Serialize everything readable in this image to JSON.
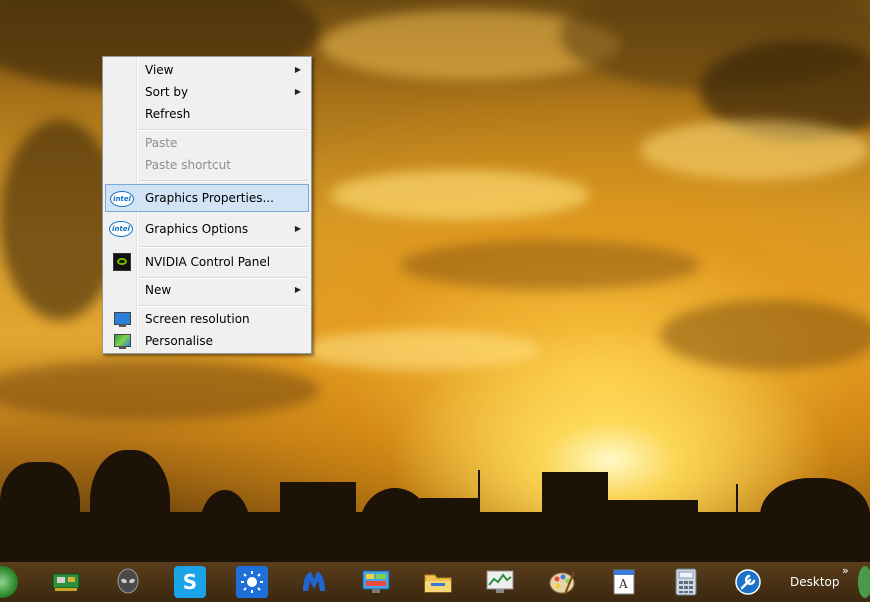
{
  "context_menu": {
    "items": [
      {
        "label": "View",
        "has_submenu": true,
        "enabled": true
      },
      {
        "label": "Sort by",
        "has_submenu": true,
        "enabled": true
      },
      {
        "label": "Refresh",
        "has_submenu": false,
        "enabled": true
      },
      {
        "label": "Paste",
        "has_submenu": false,
        "enabled": false
      },
      {
        "label": "Paste shortcut",
        "has_submenu": false,
        "enabled": false
      },
      {
        "label": "Graphics Properties...",
        "has_submenu": false,
        "enabled": true,
        "icon": "intel-icon",
        "highlighted": true
      },
      {
        "label": "Graphics Options",
        "has_submenu": true,
        "enabled": true,
        "icon": "intel-icon"
      },
      {
        "label": "NVIDIA Control Panel",
        "has_submenu": false,
        "enabled": true,
        "icon": "nvidia-icon"
      },
      {
        "label": "New",
        "has_submenu": true,
        "enabled": true
      },
      {
        "label": "Screen resolution",
        "has_submenu": false,
        "enabled": true,
        "icon": "monitor-icon"
      },
      {
        "label": "Personalise",
        "has_submenu": false,
        "enabled": true,
        "icon": "personalise-icon"
      }
    ],
    "submenu_arrow": "▶",
    "intel_text": "intel"
  },
  "taskbar": {
    "desktop_label": "Desktop",
    "overflow_chevron": "»",
    "icons": [
      "start-orb-icon",
      "network-card-icon",
      "alien-head-icon",
      "skype-icon",
      "weather-sun-icon",
      "malwarebytes-icon",
      "control-panel-icon",
      "file-explorer-icon",
      "performance-monitor-icon",
      "paint-palette-icon",
      "wordpad-icon",
      "calculator-icon",
      "repair-tool-icon"
    ]
  },
  "colors": {
    "menu_bg": "#f0f0f0",
    "menu_highlight": "#d1e3f5",
    "menu_highlight_border": "#7ca8d8",
    "disabled_text": "#8d8d8d",
    "taskbar_bg": "#4a3216",
    "intel_blue": "#0e71c5",
    "nvidia_green": "#76b900"
  }
}
